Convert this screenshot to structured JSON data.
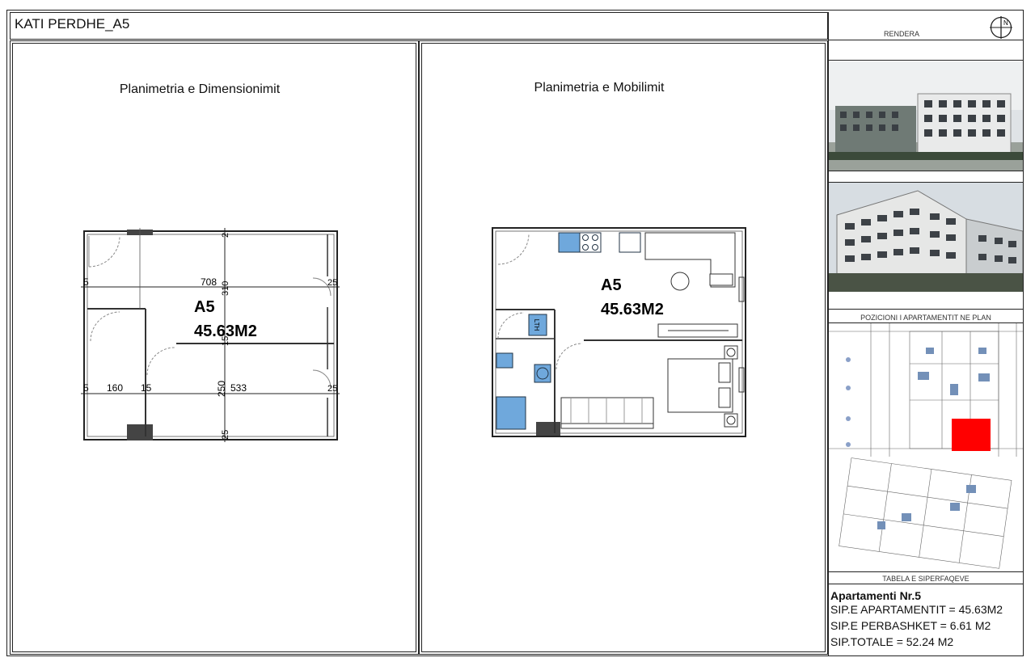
{
  "sheet": {
    "title": "KATI PERDHE_A5"
  },
  "left_panel": {
    "title": "Planimetria e Dimensionimit",
    "apartment_label": "A5",
    "area_label": "45.63M2",
    "dimensions": [
      "5",
      "708",
      "310",
      "25",
      "15",
      "5",
      "160",
      "15",
      "250",
      "533",
      "25",
      "25",
      "2"
    ]
  },
  "right_panel": {
    "title": "Planimetria e Mobilimit",
    "apartment_label": "A5",
    "area_label": "45.63M2",
    "fixture_label": "LTH"
  },
  "sidebar": {
    "rendera_caption": "RENDERA",
    "north_symbol": "N",
    "position_caption": "POZICIONI I APARTAMENTIT NE PLAN",
    "table_caption": "TABELA E SIPERFAQEVE",
    "highlight_color": "#ff0000",
    "info": {
      "heading": "Apartamenti Nr.5",
      "line1": "SIP.E APARTAMENTIT = 45.63M2",
      "line2": "SIP.E PERBASHKET = 6.61 M2",
      "line3": "SIP.TOTALE = 52.24 M2"
    }
  }
}
